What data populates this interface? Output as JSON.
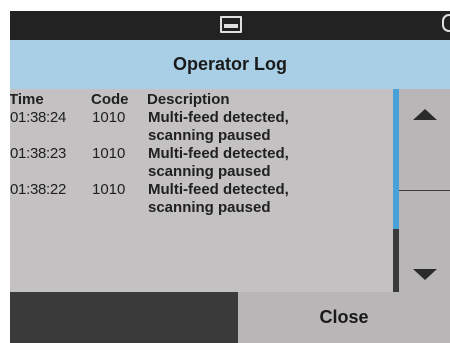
{
  "window": {
    "title": "Operator Log"
  },
  "status_bar": {
    "icons": [
      "tray-icon",
      "status-icon"
    ]
  },
  "log": {
    "columns": {
      "time": "Time",
      "code": "Code",
      "description": "Description"
    },
    "rows": [
      {
        "time": "01:38:24",
        "code": "1010",
        "desc_line1": "Multi-feed detected,",
        "desc_line2": "scanning paused"
      },
      {
        "time": "01:38:23",
        "code": "1010",
        "desc_line1": "Multi-feed detected,",
        "desc_line2": "scanning paused"
      },
      {
        "time": "01:38:22",
        "code": "1010",
        "desc_line1": "Multi-feed detected,",
        "desc_line2": "scanning paused"
      }
    ]
  },
  "scroll": {
    "up_icon": "triangle-up-icon",
    "down_icon": "triangle-down-icon"
  },
  "footer": {
    "close_label": "Close"
  },
  "colors": {
    "title_bar": "#a9cfe6",
    "log_background": "#c4c1c2",
    "button_background": "#b9b6b7",
    "scroll_thumb": "#4aa0d8",
    "chrome_dark": "#3a3a3a",
    "status_bar": "#222222"
  }
}
